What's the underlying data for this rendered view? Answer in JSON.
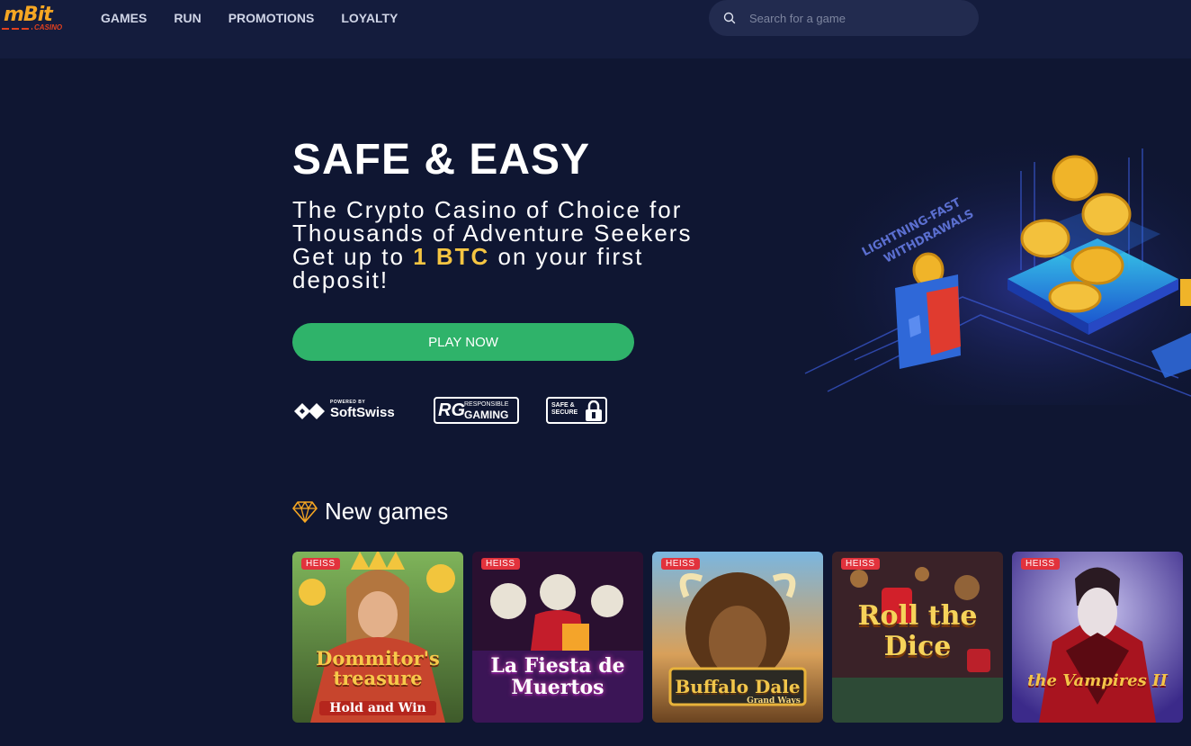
{
  "header": {
    "logo_text": "mBit",
    "logo_sub": "CASINO",
    "nav": [
      "GAMES",
      "RUN",
      "PROMOTIONS",
      "LOYALTY"
    ],
    "search_placeholder": "Search for a game"
  },
  "hero": {
    "title": "SAFE & EASY",
    "subtitle_before": "The Crypto Casino of Choice for Thousands of Adventure Seekers Get up to ",
    "subtitle_highlight": "1 BTC",
    "subtitle_after": " on your first deposit!",
    "cta_label": "PLAY NOW",
    "art_texts": [
      "LIGHTNING-FAST",
      "WITHDRAWALS"
    ]
  },
  "badges": {
    "softswiss_powered": "POWERED BY",
    "softswiss_name": "SoftSwiss",
    "rg_mark": "RG",
    "rg_line1": "RESPONSIBLE",
    "rg_line2": "GAMING",
    "secure_line1": "SAFE &",
    "secure_line2": "SECURE"
  },
  "new_games": {
    "title": "New games",
    "games": [
      {
        "tag": "HEISS",
        "name": "Dommitor's treasure",
        "subline": "Hold and Win"
      },
      {
        "tag": "HEISS",
        "name": "La Fiesta de Muertos",
        "subline": ""
      },
      {
        "tag": "HEISS",
        "name": "Buffalo Dale",
        "subline": "Grand Ways"
      },
      {
        "tag": "HEISS",
        "name": "Roll the Dice",
        "subline": ""
      },
      {
        "tag": "HEISS",
        "name": "the Vampires II",
        "subline": ""
      }
    ]
  },
  "colors": {
    "background": "#0f1632",
    "header": "#141c3d",
    "accent_green": "#2fb36a",
    "highlight_gold": "#f5c542",
    "hot_tag": "#e2323c"
  }
}
